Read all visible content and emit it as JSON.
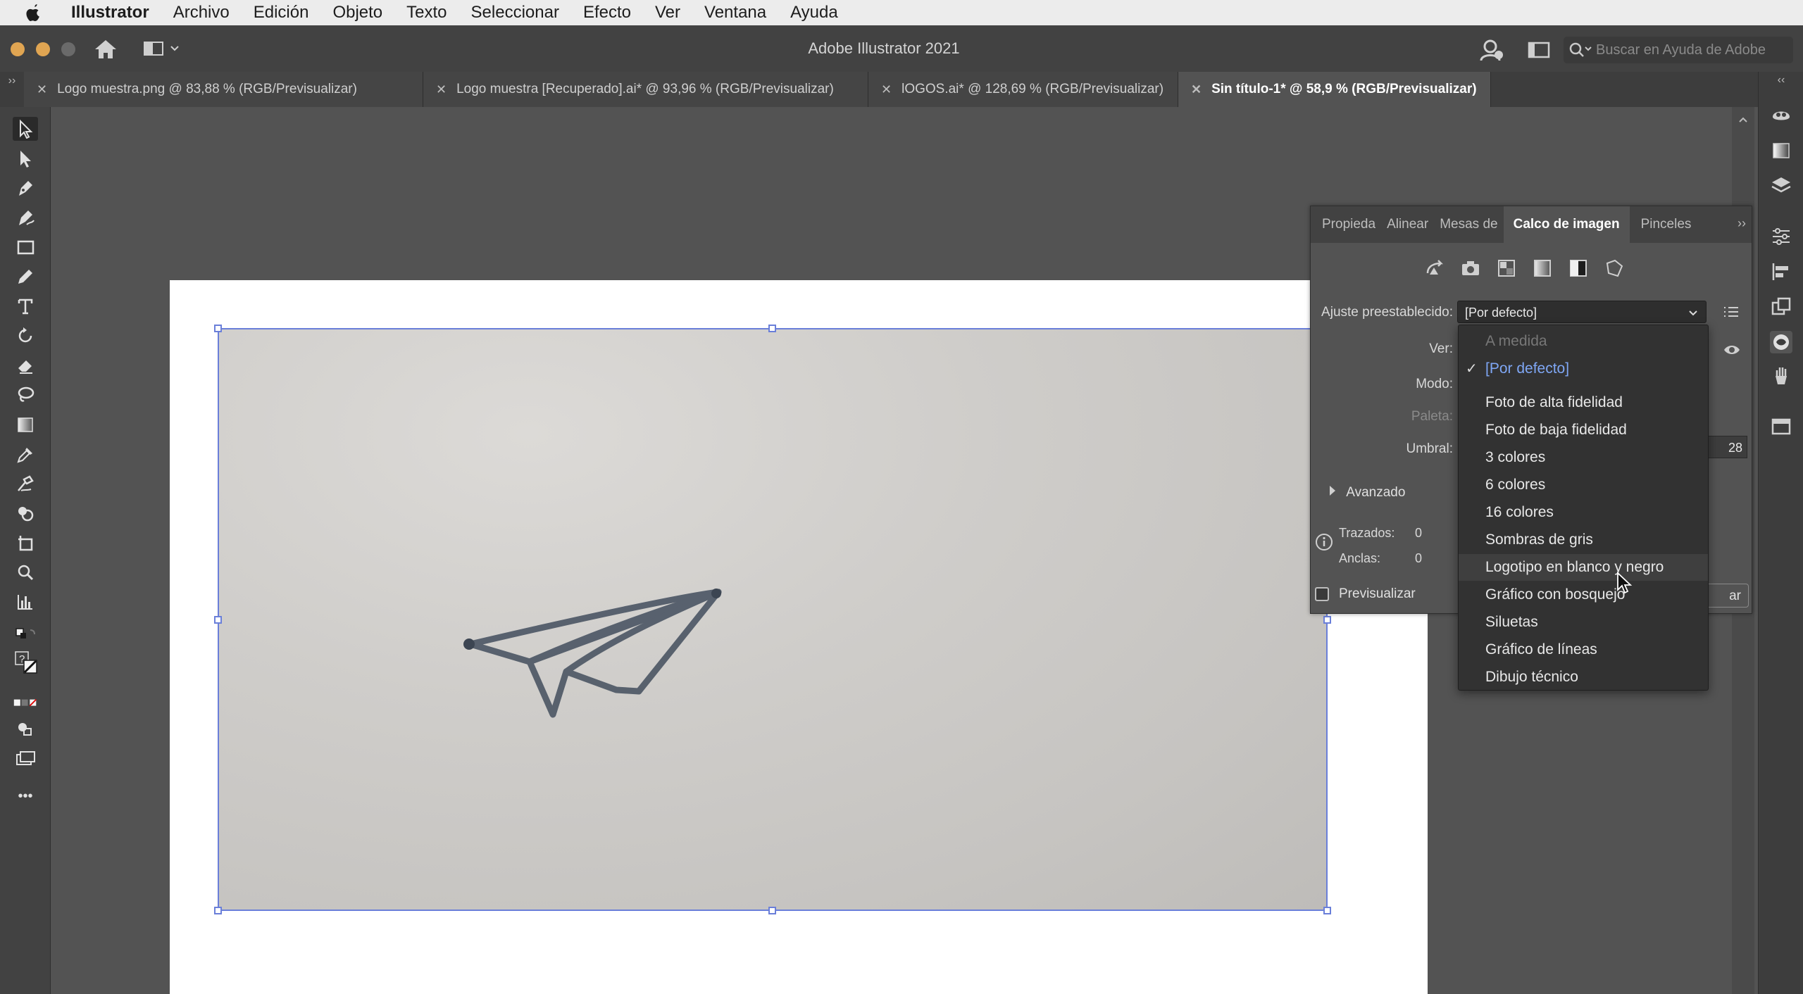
{
  "menubar": {
    "app_name": "Illustrator",
    "items": [
      "Archivo",
      "Edición",
      "Objeto",
      "Texto",
      "Seleccionar",
      "Efecto",
      "Ver",
      "Ventana",
      "Ayuda"
    ]
  },
  "window": {
    "title": "Adobe Illustrator 2021",
    "help_search_placeholder": "Buscar en Ayuda de Adobe"
  },
  "tabs": [
    {
      "label": "Logo muestra.png @ 83,88 % (RGB/Previsualizar)",
      "active": false
    },
    {
      "label": "Logo muestra [Recuperado].ai* @ 93,96 % (RGB/Previsualizar)",
      "active": false
    },
    {
      "label": "lOGOS.ai* @ 128,69 % (RGB/Previsualizar)",
      "active": false
    },
    {
      "label": "Sin título-1* @ 58,9 % (RGB/Previsualizar)",
      "active": true
    }
  ],
  "toolbar": {
    "tools": [
      "selection-tool",
      "direct-selection-tool",
      "pen-tool",
      "curvature-tool",
      "rectangle-tool",
      "pencil-tool",
      "type-tool",
      "rotate-tool",
      "eraser-tool",
      "lasso-tool",
      "gradient-tool",
      "eyedropper-tool",
      "blend-tool",
      "shape-builder-tool",
      "artboard-tool",
      "zoom-tool",
      "graph-tool"
    ],
    "fill_stroke_label": "?",
    "more_label": "•••"
  },
  "trace_panel": {
    "tabs": [
      "Propieda",
      "Alinear",
      "Mesas de",
      "Calco de imagen",
      "Pinceles"
    ],
    "active_tab": "Calco de imagen",
    "preset_icons": [
      "auto-color-icon",
      "high-color-icon",
      "low-color-icon",
      "grayscale-icon",
      "black-and-white-icon",
      "outline-icon"
    ],
    "preset_label": "Ajuste preestablecido:",
    "preset_value": "[Por defecto]",
    "view_label": "Ver:",
    "mode_label": "Modo:",
    "palette_label": "Paleta:",
    "threshold_label": "Umbral:",
    "threshold_value": "28",
    "advanced_label": "Avanzado",
    "paths_label": "Trazados:",
    "paths_value": "0",
    "anchors_label": "Anclas:",
    "anchors_value": "0",
    "preview_label": "Previsualizar",
    "trace_button_label": "ar"
  },
  "preset_dropdown": {
    "items": [
      {
        "label": "A medida",
        "state": "disabled"
      },
      {
        "label": "[Por defecto]",
        "state": "checked"
      },
      {
        "label": "Foto de alta fidelidad",
        "state": "normal"
      },
      {
        "label": "Foto de baja fidelidad",
        "state": "normal"
      },
      {
        "label": "3 colores",
        "state": "normal"
      },
      {
        "label": "6 colores",
        "state": "normal"
      },
      {
        "label": "16 colores",
        "state": "normal"
      },
      {
        "label": "Sombras de gris",
        "state": "normal"
      },
      {
        "label": "Logotipo en blanco y negro",
        "state": "hover"
      },
      {
        "label": "Gráfico con bosquejo",
        "state": "normal"
      },
      {
        "label": "Siluetas",
        "state": "normal"
      },
      {
        "label": "Gráfico de líneas",
        "state": "normal"
      },
      {
        "label": "Dibujo técnico",
        "state": "normal"
      }
    ]
  },
  "colors": {
    "selection_blue": "#6a7fd9",
    "checked_item_blue": "#7fa7f5",
    "traffic_yellow": "#e0a552"
  }
}
